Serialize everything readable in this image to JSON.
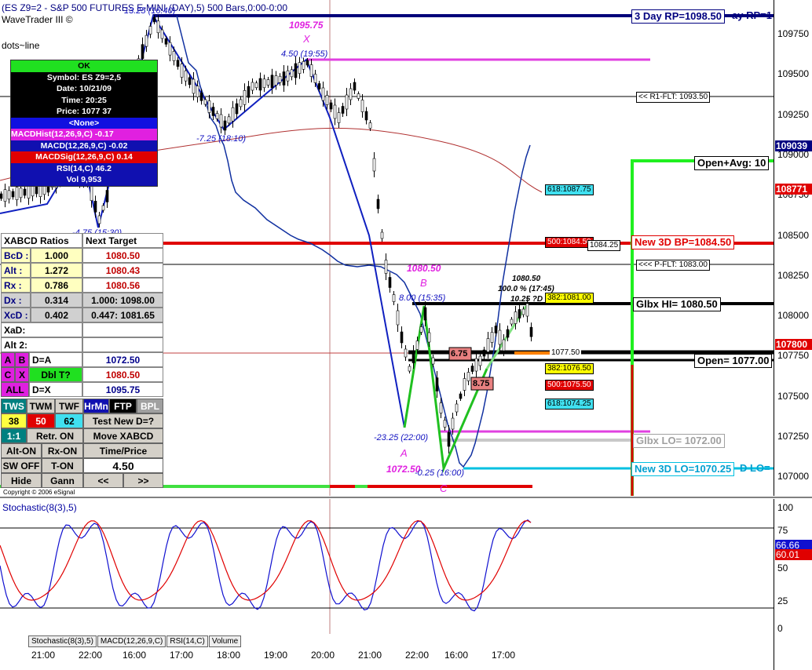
{
  "header": {
    "title": "(ES Z9=2 - S&P 500 FUTURES E-MINI (DAY),5) 500 Bars,0:00-0:00",
    "app_name": "WaveTrader III ©",
    "study": "dots~line",
    "copyright": "Copyright © 2006 eSignal",
    "stoch_title": "Stochastic(8(3),5)"
  },
  "info_box": {
    "status": "OK",
    "symbol": "Symbol: ES Z9=2,5",
    "date": "Date: 10/21/09",
    "time": "Time: 20:25",
    "price": "Price: 1077 37",
    "none": "<None>",
    "macd_hist": "MACDHist(12,26,9,C) -0.17",
    "macd": "MACD(12,26,9,C) -0.02",
    "macd_sig": "MACDSig(12,26,9,C) 0.14",
    "rsi": "RSI(14,C) 46.2",
    "vol": "Vol 9,953"
  },
  "xabcd": {
    "head_left": "XABCD Ratios",
    "head_right": "Next Target",
    "rows": [
      {
        "label": "BcD :",
        "ratio": "1.000",
        "target": "1080.50"
      },
      {
        "label": "Alt  :",
        "ratio": "1.272",
        "target": "1080.43"
      },
      {
        "label": "Rx   :",
        "ratio": "0.786",
        "target": "1080.56"
      },
      {
        "label": "Dx   :",
        "ratio": "0.314",
        "target": "1.000: 1098.00"
      },
      {
        "label": "XcD :",
        "ratio": "0.402",
        "target": "0.447: 1081.65"
      }
    ],
    "xad": "XaD:",
    "alt2": "Alt 2:",
    "dA_label": "D=A",
    "dA_value": "1072.50",
    "dbl_label": "Dbl T?",
    "dbl_value": "1080.50",
    "dX_label": "D=X",
    "dX_value": "1095.75",
    "keys": {
      "a": "A",
      "b": "B",
      "c": "C",
      "x": "X",
      "all": "ALL"
    }
  },
  "controls": {
    "tws": "TWS",
    "twm": "TWM",
    "twf": "TWF",
    "hrmn": "HrMn",
    "ftp": "FTP",
    "bpl": "BPL",
    "n38": "38",
    "n50": "50",
    "n62": "62",
    "test": "Test New D=?",
    "r11": "1:1",
    "retr": "Retr. ON",
    "move": "Move XABCD",
    "alt_on": "Alt-ON",
    "rx_on": "Rx-ON",
    "time_price": "Time/Price",
    "sw_off": "SW OFF",
    "t_on": "T-ON",
    "value": "4.50",
    "hide": "Hide",
    "gann": "Gann",
    "prev": "<<",
    "next": ">>"
  },
  "price_axis": {
    "ticks": [
      "109750",
      "109500",
      "109250",
      "109000",
      "108750",
      "108500",
      "108250",
      "108000",
      "107750",
      "107500",
      "107250",
      "107000"
    ],
    "tag_current": "109039",
    "tag_red1": "108771",
    "tag_red2": "107800"
  },
  "stoch_axis": {
    "ticks": [
      "100",
      "75",
      "50",
      "25",
      "0"
    ],
    "k": "66.66",
    "d": "60.01"
  },
  "time_axis": [
    "21:00",
    "22:00",
    "16:00",
    "17:00",
    "18:00",
    "19:00",
    "20:00",
    "21:00",
    "22:00",
    "16:00",
    "17:00"
  ],
  "tabs": [
    "Stochastic(8(3),5)",
    "MACD(12,26,9,C)",
    "RSI(14,C)",
    "Volume"
  ],
  "levels": {
    "rp3": "3 Day RP=1098.50",
    "rp3_b": "ay RP=1",
    "r1flt": "<< R1-FLT: 1093.50",
    "open_avg": "Open+Avg: 10",
    "bp3": "New 3D BP=1084.50",
    "bp_small": "1084.25",
    "pflt": "<<< P-FLT: 1083.00",
    "glbx_hi": "Glbx HI= 1080.50",
    "open": "Open= 1077.00",
    "open_small": "1077.50",
    "glbx_lo": "Glbx LO= 1072.00",
    "lo3": "New 3D LO=1070.25",
    "lo3_b": "D LO="
  },
  "fib_tags": {
    "f618a": "618:1087.75",
    "f500a": "500:1084.50",
    "f382a": "382:1081.00",
    "f382b": "382:1076.50",
    "f500b": "500:1075.50",
    "f618b": "618:1074.25"
  },
  "annotations": {
    "top_wave": "13.25 (16:40)",
    "x_price": "1095.75",
    "x_label": "X",
    "wave_450": "4.50 (19:55)",
    "wave_725": "-7.25 (18:10)",
    "wave_475": "-4.75 (15:30)",
    "b_price": "1080.50",
    "b_label": "B",
    "wave_800": "8.00 (15:35)",
    "wave_2325": "-23.25 (22:00)",
    "a_label": "A",
    "a_price": "1072.50",
    "wave_025": "-0.25 (16:00)",
    "c_label": "C",
    "d_price": "1080.50",
    "d_pct": "100.0 % (17:45)",
    "d_wave": "10.25 ?D",
    "box675": "6.75",
    "box875": "8.75"
  }
}
